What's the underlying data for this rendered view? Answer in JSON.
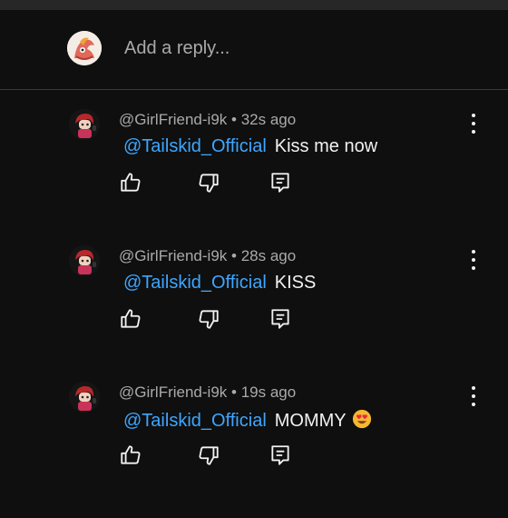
{
  "reply": {
    "placeholder": "Add a reply..."
  },
  "comments": [
    {
      "author": "@GirlFriend-i9k",
      "time": "32s ago",
      "mention": "@Tailskid_Official",
      "text": "Kiss me now",
      "emoji": ""
    },
    {
      "author": "@GirlFriend-i9k",
      "time": "28s ago",
      "mention": "@Tailskid_Official",
      "text": "KISS",
      "emoji": ""
    },
    {
      "author": "@GirlFriend-i9k",
      "time": "19s ago",
      "mention": "@Tailskid_Official",
      "text": "MOMMY",
      "emoji": "heart-eyes-emoji"
    }
  ],
  "colors": {
    "background": "#0f0f0f",
    "mention": "#3ea6ff",
    "meta": "#aaaaaa",
    "text": "#f1f1f1"
  },
  "icons": [
    "like-icon",
    "dislike-icon",
    "reply-icon",
    "more-vert-icon"
  ]
}
